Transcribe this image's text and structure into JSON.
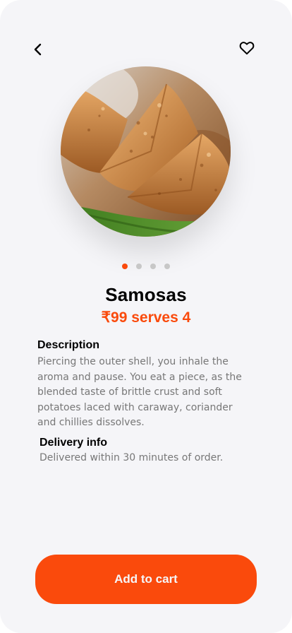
{
  "header": {
    "back_icon": "chevron-left-icon",
    "favorite_icon": "heart-outline-icon"
  },
  "hero": {
    "image_subject": "samosas",
    "carousel_total": 4,
    "carousel_active_index": 0
  },
  "product": {
    "name": "Samosas",
    "price_line": "₹99 serves 4"
  },
  "description": {
    "heading": "Description",
    "body": "Piercing the outer shell, you inhale the aroma and pause. You eat a piece, as the blended taste of brittle crust and soft potatoes laced with caraway, coriander and chillies dissolves."
  },
  "delivery": {
    "heading": "Delivery info",
    "body": "Delivered within 30 minutes of order."
  },
  "actions": {
    "add_to_cart_label": "Add to cart"
  },
  "colors": {
    "accent": "#fa4a0c",
    "background": "#f5f5f8",
    "body_text": "#777777",
    "dot_inactive": "#c7c7c7"
  }
}
